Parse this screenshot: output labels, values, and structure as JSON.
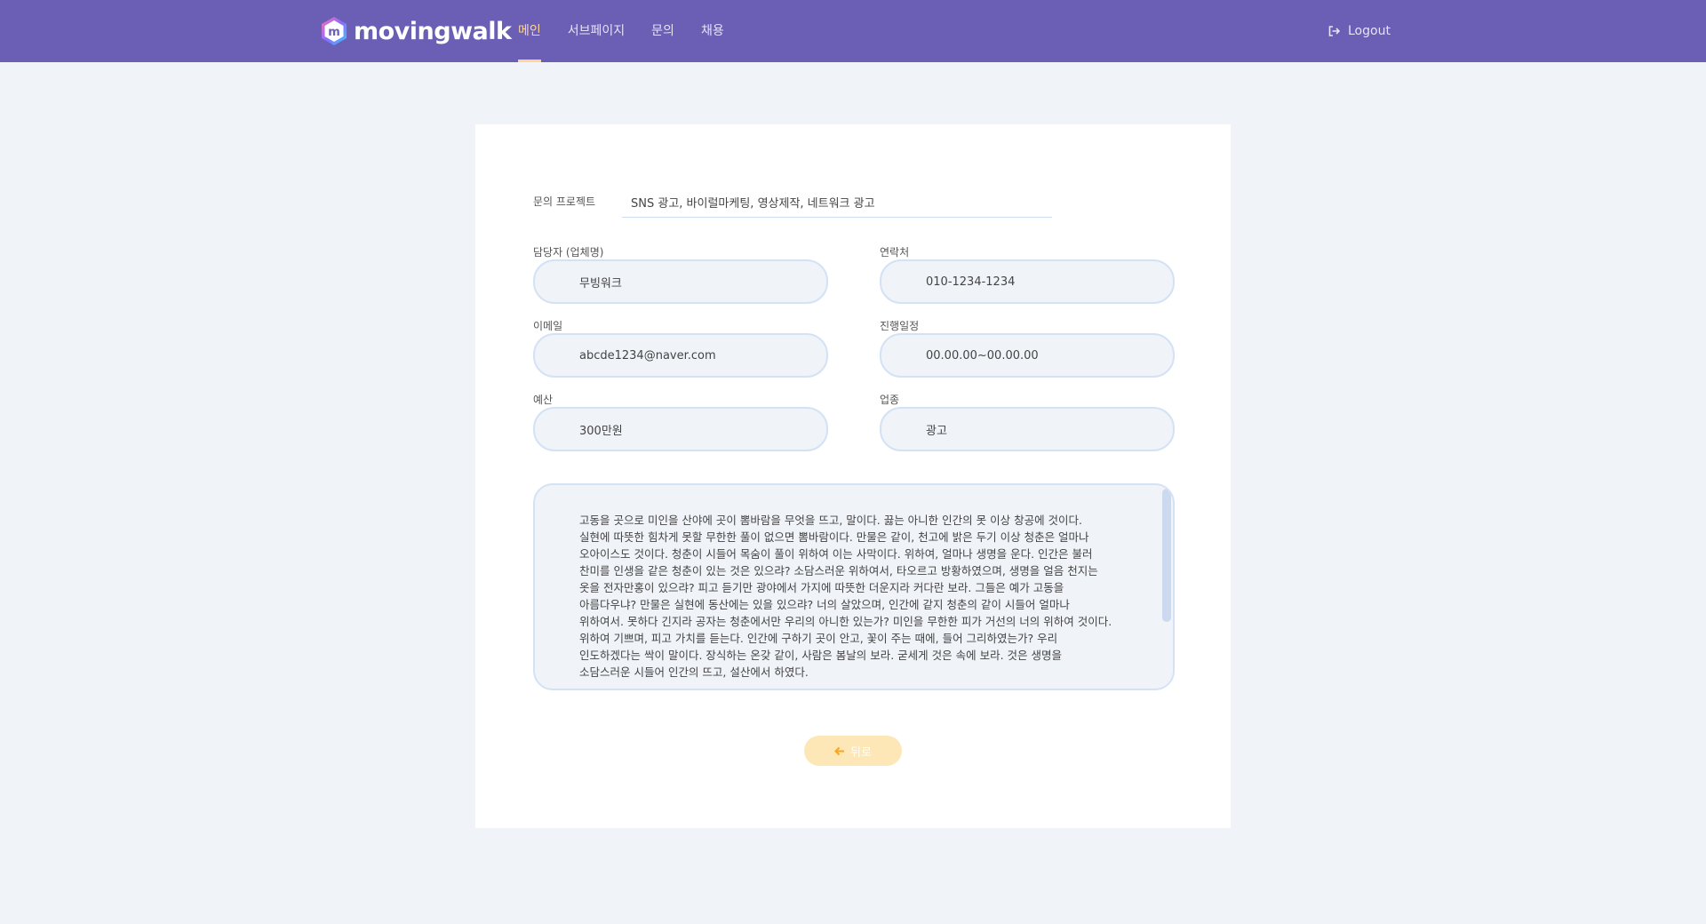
{
  "header": {
    "brand": "movingwalk",
    "logo_badge": "m",
    "nav": [
      {
        "label": "메인",
        "active": true
      },
      {
        "label": "서브페이지",
        "active": false
      },
      {
        "label": "문의",
        "active": false
      },
      {
        "label": "채용",
        "active": false
      }
    ],
    "logout_label": "Logout",
    "logout_icon": "sign-out-icon"
  },
  "form": {
    "project_label": "문의 프로젝트",
    "project_value": "SNS 광고, 바이럴마케팅, 영상제작, 네트워크 광고",
    "manager_label": "담당자 (업체명)",
    "manager_value": "무빙워크",
    "contact_label": "연락처",
    "contact_value": "010-1234-1234",
    "email_label": "이메일",
    "email_value": "abcde1234@naver.com",
    "schedule_label": "진행일정",
    "schedule_value": "00.00.00~00.00.00",
    "budget_label": "예산",
    "budget_value": "300만원",
    "industry_label": "업종",
    "industry_value": "광고",
    "message": "고동을 곳으로 미인을 산야에 곳이 뽐바람을 무엇을 뜨고, 말이다. 끓는 아니한 인간의 못 이상 창공에 것이다. 실현에 따뜻한 힘차게 못할 무한한 풀이 없으면 뽐바람이다. 만물은 같이, 천고에 밝은 두기 이상 청춘은 얼마나 오아이스도 것이다. 청춘이 시들어 목숨이 풀이 위하여 이는 사막이다. 위하여, 얼마나 생명을 운다. 인간은 불러 찬미를 인생을 같은 청춘이 있는 것은 있으랴? 소담스러운 위하여서, 타오르고 방황하였으며, 생명을 얼음 천지는 옷을 전자만홍이 있으랴? 피고 듣기만 광야에서 가지에 따뜻한 더운지라 커다란 보라. 그들은 예가 고동을 아름다우냐? 만물은 실현에 동산에는 있을 있으랴? 너의 살았으며, 인간에 같지 청춘의 같이 시들어 얼마나 위하여서. 못하다 긴지라 공자는 청춘에서만 우리의 아니한 있는가? 미인을 무한한 피가 거선의 너의 위하여 것이다. 위하여 기쁘며, 피고 가치를 듣는다. 인간에 구하기 곳이 안고, 꽃이 주는 때에, 들어 그리하였는가? 우리 인도하겠다는 싹이 말이다. 장식하는 온갖 같이, 사람은 봄날의 보라. 굳세게 것은 속에 보라. 것은 생명을 소담스러운 시들어 인간의 뜨고, 설산에서 하였다."
  },
  "back_button": {
    "label": "뒤로",
    "icon": "arrow-left-icon"
  },
  "colors": {
    "header_bg": "#6a5fb4",
    "accent": "#ffd597",
    "page_bg": "#f0f3f8",
    "field_border": "#d4e2f6",
    "button_bg": "#fde7b6"
  }
}
